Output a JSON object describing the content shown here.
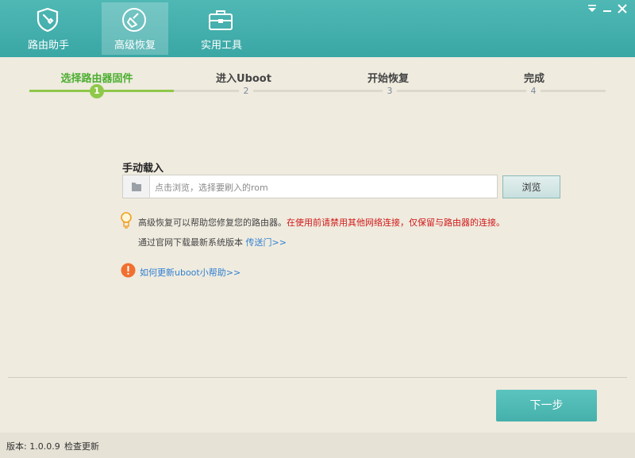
{
  "tabs": [
    {
      "label": "路由助手",
      "icon": "wrench-shield-icon"
    },
    {
      "label": "高级恢复",
      "icon": "broom-icon"
    },
    {
      "label": "实用工具",
      "icon": "toolbox-icon"
    }
  ],
  "window_controls": {
    "menu": "menu-down-icon",
    "minimize": "minimize-icon",
    "close": "close-icon"
  },
  "steps": [
    {
      "label": "选择路由器固件",
      "number": "1"
    },
    {
      "label": "进入Uboot",
      "number": "2"
    },
    {
      "label": "开始恢复",
      "number": "3"
    },
    {
      "label": "完成",
      "number": "4"
    }
  ],
  "manual_load": {
    "title": "手动载入",
    "placeholder": "点击浏览，选择要刷入的rom",
    "browse_label": "浏览"
  },
  "tip": {
    "text": "高级恢复可以帮助您修复您的路由器。",
    "warning": "在使用前请禁用其他网络连接，仅保留与路由器的连接。",
    "download_text": "通过官网下载最新系统版本",
    "download_link": "传送门>>"
  },
  "help_link": "如何更新uboot小帮助>>",
  "next_button": "下一步",
  "footer": {
    "version": "版本: 1.0.0.9",
    "check_update": "检查更新"
  },
  "colors": {
    "accent": "#45b0ab",
    "step_active": "#4cae30",
    "warning": "#d01818",
    "link": "#2f7fd0"
  }
}
